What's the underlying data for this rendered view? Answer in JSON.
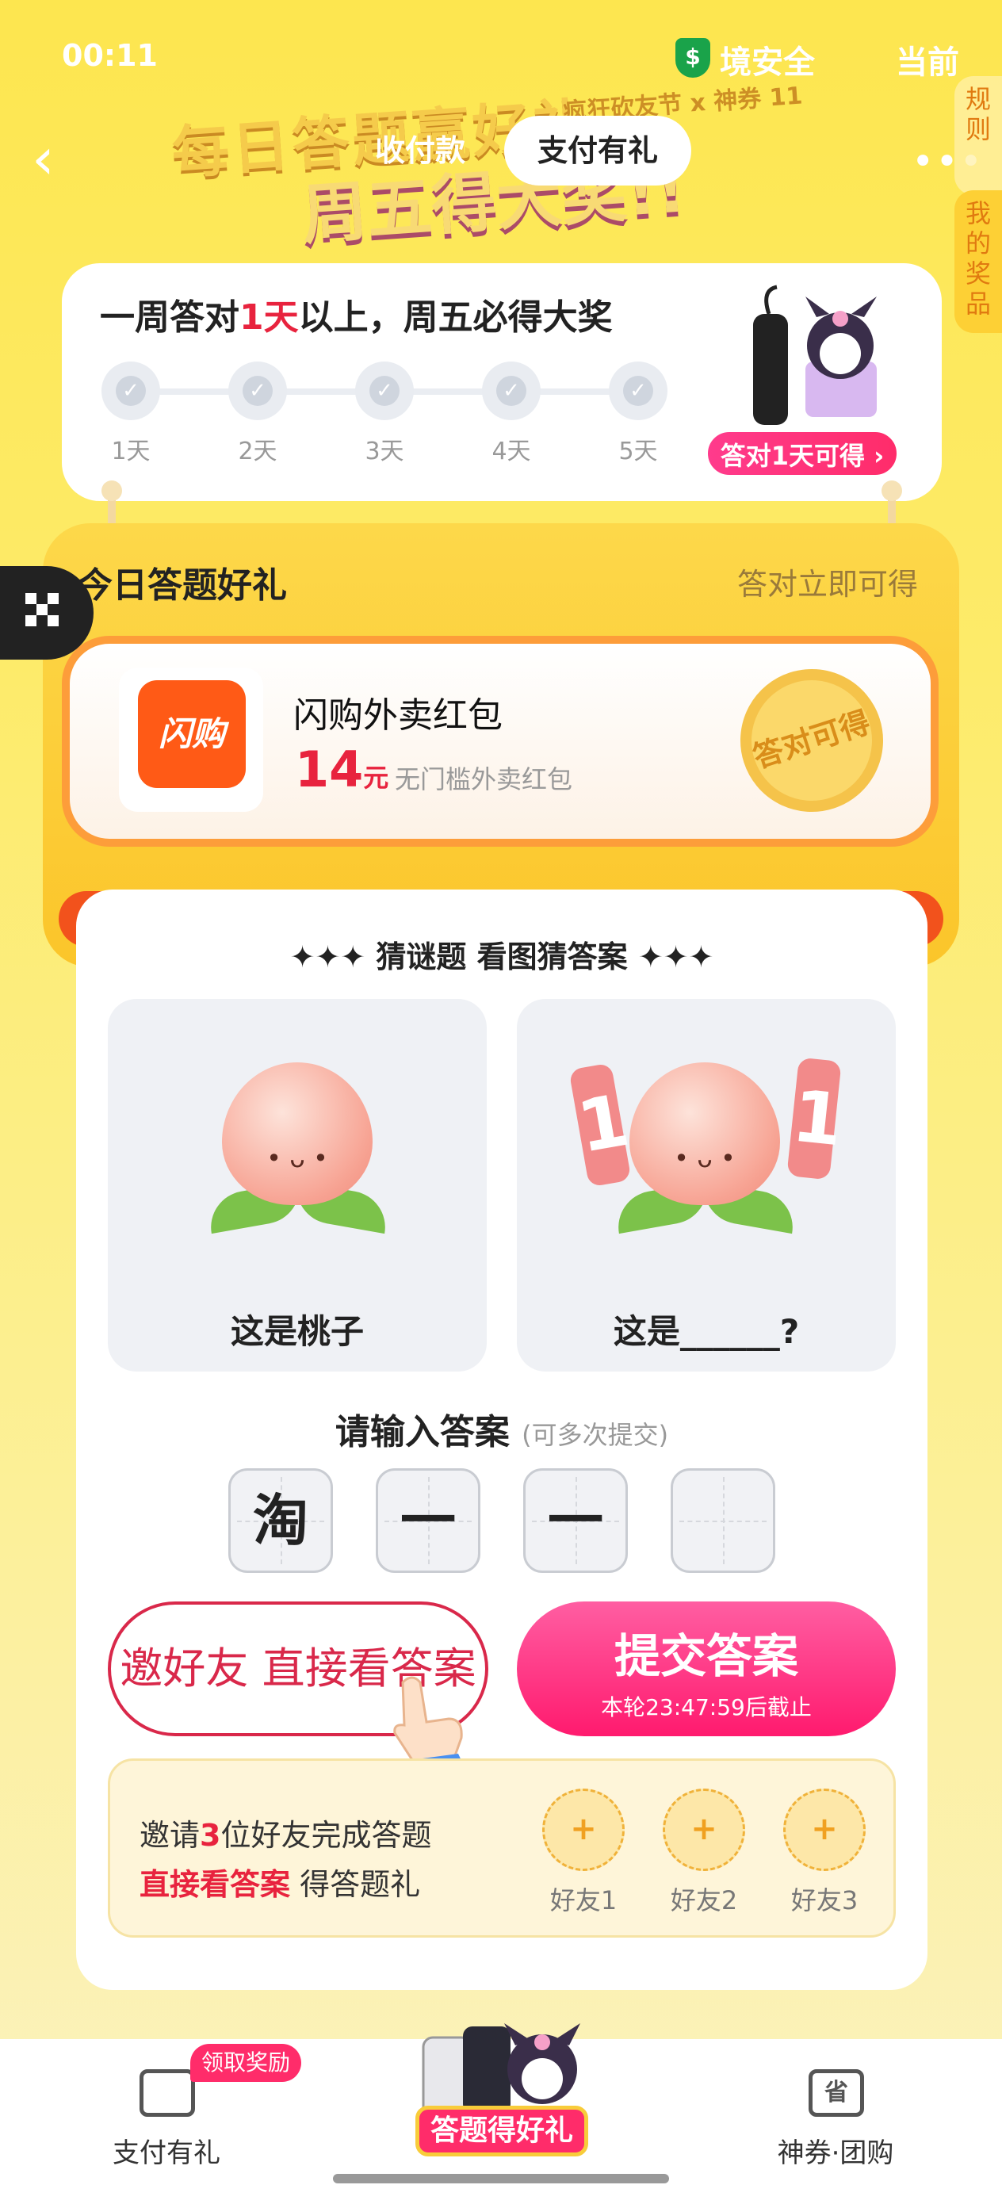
{
  "status_bar": {
    "time": "00:11",
    "safety_text": "境安全",
    "right_text": "当前",
    "shield_icon": "$"
  },
  "banner": {
    "line1": "每日答题赢好礼",
    "line2": "周五得大奖!!",
    "tag": "疯狂砍友节 x 神券 11"
  },
  "nav": {
    "tabs": [
      "收付款",
      "支付有礼"
    ],
    "active_tab": "支付有礼"
  },
  "side_tabs": {
    "rules": "规则",
    "my_prizes": "我的奖品"
  },
  "week": {
    "title_prefix": "一周答对",
    "title_highlight": "1天",
    "title_suffix": "以上，周五必得大奖",
    "days": [
      "1天",
      "2天",
      "3天",
      "4天",
      "5天"
    ],
    "check": "✓",
    "prize_pill": "答对1天可得 ›"
  },
  "today": {
    "title": "今日答题好礼",
    "right_label": "答对立即可得",
    "app_name": "闪购",
    "gift_name": "闪购外卖红包",
    "amount": "14",
    "unit": "元",
    "desc": "无门槛外卖红包",
    "stamp": "答对可得"
  },
  "quiz": {
    "heading": "✦✦✦ 猜谜题 看图猜答案 ✦✦✦",
    "left_caption": "这是桃子",
    "right_caption": "这是______?",
    "num_left": "1",
    "num_right": "1",
    "face": "• ᴗ •",
    "input_label": "请输入答案",
    "input_sub": "(可多次提交)",
    "cells": [
      "淘",
      "一",
      "一",
      ""
    ]
  },
  "actions": {
    "invite_label": "邀好友 直接看答案",
    "submit_label": "提交答案",
    "submit_sub": "本轮23:47:59后截止"
  },
  "invite": {
    "line1_prefix": "邀请",
    "line1_count": "3",
    "line1_suffix": "位好友完成答题",
    "line2_highlight": "直接看答案",
    "line2_suffix": " 得答题礼",
    "plus": "+",
    "friends": [
      "好友1",
      "好友2",
      "好友3"
    ]
  },
  "tabbar": {
    "left_label": "支付有礼",
    "left_badge": "领取奖励",
    "center_label": "答题得好礼",
    "right_label": "神券·团购",
    "right_icon_text": "省"
  },
  "colors": {
    "accent_red": "#e8233e",
    "pink": "#ff2c6a",
    "yellow": "#fde64f",
    "orange": "#ff5a16"
  }
}
